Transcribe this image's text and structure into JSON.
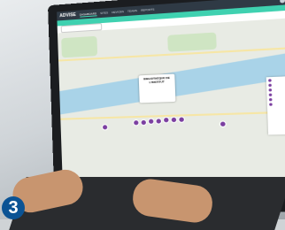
{
  "app": {
    "logo": "ADVISE",
    "active_tab": "DASHBOARD"
  },
  "nav": [
    "DASHBOARD",
    "SITES",
    "DEVICES",
    "TEAMS",
    "REPORTS"
  ],
  "banner": {
    "text": ""
  },
  "toolbar": {
    "search_placeholder": ""
  },
  "popup": {
    "title": "BIBLIOTHEQUE DE L'INSTITUT",
    "subtitle": "",
    "button": ""
  },
  "side_panel": {
    "items": [
      "",
      "",
      "",
      "",
      "",
      ""
    ]
  },
  "step_badge": "3",
  "colors": {
    "accent": "#3fd1b0",
    "marker": "#7b3fa0",
    "badge": "#0b5394"
  }
}
